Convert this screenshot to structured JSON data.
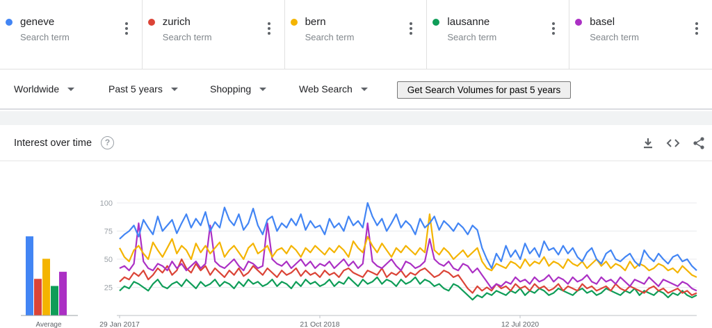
{
  "terms": [
    {
      "name": "geneve",
      "sub": "Search term",
      "color": "#4285f4"
    },
    {
      "name": "zurich",
      "sub": "Search term",
      "color": "#db4437"
    },
    {
      "name": "bern",
      "sub": "Search term",
      "color": "#f4b400"
    },
    {
      "name": "lausanne",
      "sub": "Search term",
      "color": "#0f9d58"
    },
    {
      "name": "basel",
      "sub": "Search term",
      "color": "#ab30c4"
    }
  ],
  "filters": {
    "region": "Worldwide",
    "time": "Past 5 years",
    "category": "Shopping",
    "property": "Web Search",
    "volume_button": "Get Search Volumes for past 5 years"
  },
  "card": {
    "title": "Interest over time",
    "help_icon": "help-circle-icon",
    "tools": [
      "download-icon",
      "embed-code-icon",
      "share-icon"
    ]
  },
  "chart_data": {
    "type": "line",
    "x_ticks": [
      "29 Jan 2017",
      "21 Oct 2018",
      "12 Jul 2020"
    ],
    "y_ticks": [
      25,
      50,
      75,
      100
    ],
    "ylim": [
      0,
      100
    ],
    "average_label": "Average",
    "averages": [
      {
        "name": "geneve",
        "value": 67
      },
      {
        "name": "zurich",
        "value": 31
      },
      {
        "name": "bern",
        "value": 48
      },
      {
        "name": "lausanne",
        "value": 25
      },
      {
        "name": "basel",
        "value": 37
      }
    ],
    "series": [
      {
        "name": "geneve",
        "values": [
          68,
          72,
          75,
          80,
          70,
          85,
          78,
          72,
          88,
          75,
          80,
          85,
          73,
          82,
          90,
          78,
          86,
          80,
          92,
          75,
          83,
          78,
          96,
          85,
          80,
          90,
          76,
          82,
          95,
          80,
          72,
          85,
          88,
          75,
          82,
          78,
          86,
          80,
          90,
          76,
          84,
          78,
          80,
          72,
          86,
          78,
          82,
          75,
          88,
          80,
          84,
          78,
          100,
          88,
          80,
          86,
          75,
          82,
          90,
          78,
          84,
          80,
          72,
          86,
          78,
          82,
          88,
          76,
          84,
          80,
          75,
          82,
          78,
          72,
          80,
          76,
          60,
          50,
          42,
          55,
          48,
          62,
          52,
          58,
          50,
          64,
          55,
          60,
          52,
          66,
          58,
          60,
          54,
          62,
          55,
          60,
          52,
          48,
          56,
          60,
          50,
          46,
          55,
          58,
          50,
          48,
          52,
          55,
          48,
          44,
          58,
          52,
          48,
          55,
          50,
          46,
          52,
          54,
          48,
          50,
          44,
          40
        ]
      },
      {
        "name": "zurich",
        "values": [
          30,
          34,
          32,
          38,
          35,
          40,
          32,
          36,
          42,
          38,
          44,
          36,
          40,
          50,
          42,
          38,
          46,
          40,
          44,
          36,
          42,
          38,
          34,
          40,
          36,
          42,
          35,
          38,
          44,
          40,
          36,
          42,
          38,
          34,
          40,
          36,
          38,
          42,
          35,
          40,
          36,
          38,
          34,
          40,
          36,
          38,
          34,
          40,
          42,
          38,
          36,
          34,
          40,
          38,
          36,
          42,
          34,
          38,
          36,
          40,
          34,
          38,
          36,
          40,
          42,
          38,
          34,
          36,
          40,
          38,
          34,
          36,
          30,
          24,
          20,
          26,
          22,
          25,
          22,
          28,
          24,
          26,
          22,
          28,
          24,
          26,
          22,
          28,
          24,
          26,
          22,
          24,
          28,
          22,
          26,
          24,
          22,
          28,
          24,
          26,
          22,
          24,
          26,
          22,
          28,
          24,
          22,
          26,
          24,
          22,
          20,
          24,
          26,
          22,
          24,
          20,
          22,
          24,
          20,
          22,
          18,
          20
        ]
      },
      {
        "name": "bern",
        "values": [
          60,
          52,
          48,
          58,
          62,
          55,
          50,
          65,
          58,
          52,
          60,
          68,
          55,
          62,
          58,
          50,
          64,
          56,
          62,
          55,
          60,
          65,
          52,
          58,
          62,
          56,
          50,
          60,
          64,
          55,
          58,
          62,
          52,
          58,
          60,
          55,
          62,
          58,
          52,
          60,
          56,
          62,
          58,
          54,
          60,
          56,
          62,
          58,
          52,
          66,
          60,
          56,
          70,
          62,
          56,
          64,
          58,
          52,
          60,
          56,
          62,
          58,
          54,
          60,
          56,
          90,
          58,
          54,
          60,
          56,
          50,
          54,
          58,
          52,
          56,
          60,
          48,
          42,
          40,
          46,
          44,
          42,
          48,
          46,
          42,
          50,
          44,
          48,
          46,
          52,
          44,
          48,
          46,
          42,
          50,
          46,
          44,
          48,
          42,
          46,
          50,
          44,
          48,
          42,
          46,
          44,
          40,
          48,
          42,
          46,
          44,
          40,
          42,
          46,
          44,
          40,
          42,
          38,
          44,
          40,
          36,
          34
        ]
      },
      {
        "name": "lausanne",
        "values": [
          22,
          26,
          24,
          30,
          28,
          25,
          22,
          28,
          32,
          26,
          24,
          28,
          30,
          26,
          32,
          28,
          24,
          30,
          26,
          28,
          32,
          26,
          30,
          28,
          24,
          30,
          26,
          32,
          28,
          30,
          26,
          28,
          32,
          26,
          30,
          28,
          24,
          30,
          26,
          32,
          28,
          30,
          26,
          28,
          32,
          26,
          30,
          28,
          34,
          30,
          26,
          32,
          28,
          30,
          34,
          28,
          32,
          30,
          26,
          32,
          28,
          30,
          34,
          28,
          32,
          30,
          26,
          28,
          24,
          22,
          28,
          26,
          22,
          18,
          14,
          18,
          16,
          20,
          18,
          22,
          20,
          18,
          22,
          20,
          24,
          18,
          22,
          20,
          24,
          22,
          18,
          20,
          24,
          22,
          20,
          18,
          22,
          24,
          20,
          22,
          18,
          20,
          24,
          22,
          20,
          18,
          22,
          20,
          24,
          18,
          22,
          20,
          18,
          22,
          20,
          16,
          20,
          18,
          22,
          18,
          16,
          18
        ]
      },
      {
        "name": "basel",
        "values": [
          42,
          44,
          40,
          46,
          82,
          48,
          42,
          40,
          46,
          44,
          40,
          48,
          42,
          46,
          40,
          44,
          48,
          42,
          46,
          80,
          48,
          44,
          42,
          46,
          50,
          44,
          40,
          48,
          46,
          42,
          44,
          82,
          50,
          46,
          44,
          48,
          42,
          46,
          50,
          44,
          48,
          42,
          46,
          44,
          48,
          42,
          46,
          50,
          44,
          48,
          42,
          46,
          82,
          48,
          44,
          42,
          46,
          50,
          44,
          40,
          48,
          46,
          42,
          44,
          48,
          68,
          50,
          46,
          44,
          48,
          42,
          40,
          46,
          44,
          38,
          42,
          36,
          30,
          24,
          28,
          26,
          30,
          28,
          34,
          30,
          32,
          28,
          34,
          30,
          32,
          36,
          30,
          34,
          32,
          28,
          34,
          30,
          32,
          36,
          30,
          28,
          34,
          30,
          32,
          28,
          34,
          30,
          26,
          32,
          30,
          28,
          34,
          30,
          26,
          32,
          30,
          28,
          26,
          30,
          28,
          24,
          22
        ]
      }
    ]
  }
}
